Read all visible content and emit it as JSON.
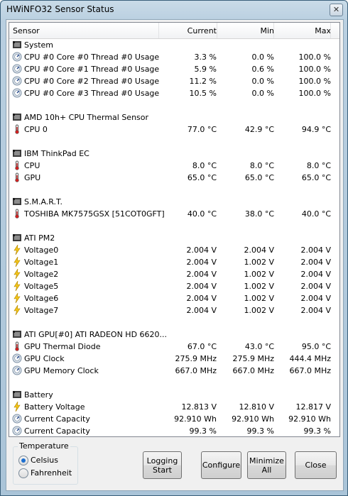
{
  "window": {
    "title": "HWiNFO32 Sensor Status",
    "close_glyph": "✕"
  },
  "columns": {
    "sensor": "Sensor",
    "current": "Current",
    "min": "Min",
    "max": "Max"
  },
  "groups": [
    {
      "name": "System",
      "icon": "chip-icon",
      "rows": [
        {
          "icon": "gauge-icon",
          "name": "CPU #0 Core #0 Thread #0 Usage",
          "current": "3.3 %",
          "min": "0.0 %",
          "max": "100.0 %"
        },
        {
          "icon": "gauge-icon",
          "name": "CPU #0 Core #1 Thread #0 Usage",
          "current": "5.9 %",
          "min": "0.6 %",
          "max": "100.0 %"
        },
        {
          "icon": "gauge-icon",
          "name": "CPU #0 Core #2 Thread #0 Usage",
          "current": "11.2 %",
          "min": "0.0 %",
          "max": "100.0 %"
        },
        {
          "icon": "gauge-icon",
          "name": "CPU #0 Core #3 Thread #0 Usage",
          "current": "10.5 %",
          "min": "0.0 %",
          "max": "100.0 %"
        }
      ]
    },
    {
      "name": "AMD 10h+ CPU Thermal Sensor",
      "icon": "chip-icon",
      "rows": [
        {
          "icon": "thermometer-icon",
          "name": "CPU 0",
          "current": "77.0 °C",
          "min": "42.9 °C",
          "max": "94.9 °C"
        }
      ]
    },
    {
      "name": "IBM ThinkPad EC",
      "icon": "chip-icon",
      "rows": [
        {
          "icon": "thermometer-icon",
          "name": "CPU",
          "current": "8.0 °C",
          "min": "8.0 °C",
          "max": "8.0 °C"
        },
        {
          "icon": "thermometer-icon",
          "name": "GPU",
          "current": "65.0 °C",
          "min": "65.0 °C",
          "max": "65.0 °C"
        }
      ]
    },
    {
      "name": "S.M.A.R.T.",
      "icon": "chip-icon",
      "rows": [
        {
          "icon": "thermometer-icon",
          "name": "TOSHIBA MK7575GSX [51COT0GFT]",
          "current": "40.0 °C",
          "min": "38.0 °C",
          "max": "40.0 °C"
        }
      ]
    },
    {
      "name": "ATI PM2",
      "icon": "chip-icon",
      "rows": [
        {
          "icon": "lightning-icon",
          "name": "Voltage0",
          "current": "2.004 V",
          "min": "2.004 V",
          "max": "2.004 V"
        },
        {
          "icon": "lightning-icon",
          "name": "Voltage1",
          "current": "2.004 V",
          "min": "1.002 V",
          "max": "2.004 V"
        },
        {
          "icon": "lightning-icon",
          "name": "Voltage2",
          "current": "2.004 V",
          "min": "1.002 V",
          "max": "2.004 V"
        },
        {
          "icon": "lightning-icon",
          "name": "Voltage5",
          "current": "2.004 V",
          "min": "1.002 V",
          "max": "2.004 V"
        },
        {
          "icon": "lightning-icon",
          "name": "Voltage6",
          "current": "2.004 V",
          "min": "1.002 V",
          "max": "2.004 V"
        },
        {
          "icon": "lightning-icon",
          "name": "Voltage7",
          "current": "2.004 V",
          "min": "1.002 V",
          "max": "2.004 V"
        }
      ]
    },
    {
      "name": "ATI GPU[#0] ATI RADEON HD 6620...",
      "icon": "chip-icon",
      "rows": [
        {
          "icon": "thermometer-icon",
          "name": "GPU Thermal Diode",
          "current": "67.0 °C",
          "min": "43.0 °C",
          "max": "95.0 °C"
        },
        {
          "icon": "gauge-icon",
          "name": "GPU Clock",
          "current": "275.9 MHz",
          "min": "275.9 MHz",
          "max": "444.4 MHz"
        },
        {
          "icon": "gauge-icon",
          "name": "GPU Memory Clock",
          "current": "667.0 MHz",
          "min": "667.0 MHz",
          "max": "667.0 MHz"
        }
      ]
    },
    {
      "name": "Battery",
      "icon": "chip-icon",
      "rows": [
        {
          "icon": "lightning-icon",
          "name": "Battery Voltage",
          "current": "12.813 V",
          "min": "12.810 V",
          "max": "12.817 V"
        },
        {
          "icon": "gauge-icon",
          "name": "Current Capacity",
          "current": "92.910 Wh",
          "min": "92.910 Wh",
          "max": "92.910 Wh"
        },
        {
          "icon": "gauge-icon",
          "name": "Current Capacity",
          "current": "99.3 %",
          "min": "99.3 %",
          "max": "99.3 %"
        }
      ]
    }
  ],
  "temperature": {
    "legend": "Temperature",
    "celsius": "Celsius",
    "fahrenheit": "Fahrenheit",
    "selected": "celsius"
  },
  "buttons": {
    "logging_line1": "Logging",
    "logging_line2": "Start",
    "configure": "Configure",
    "minimize_line1": "Minimize",
    "minimize_line2": "All",
    "close": "Close"
  }
}
